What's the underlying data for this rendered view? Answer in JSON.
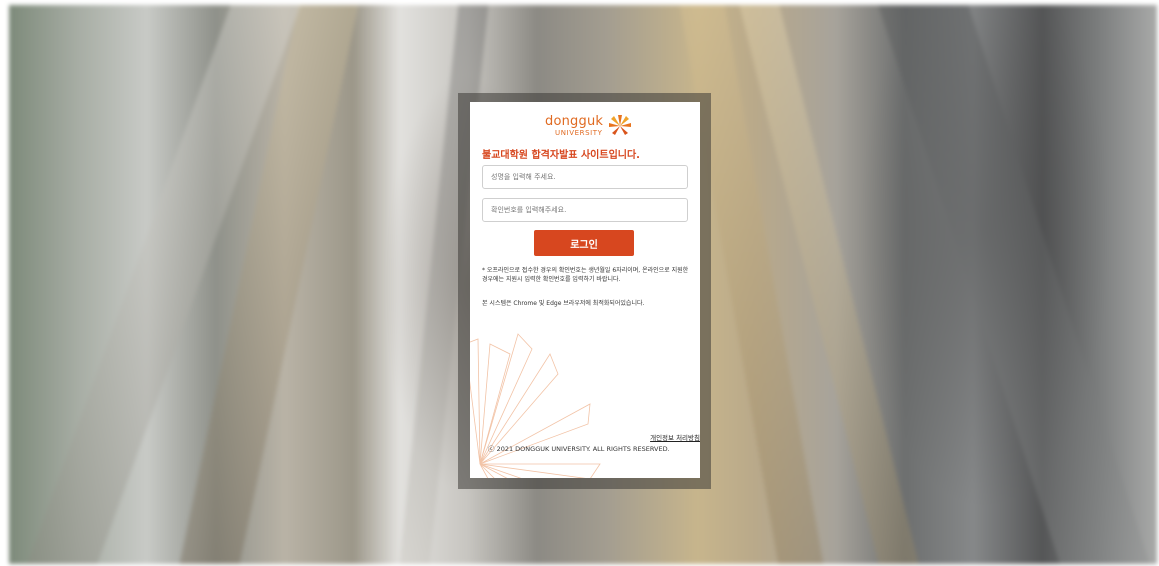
{
  "brand": {
    "logo_word": "dongguk",
    "logo_sub": "UNIVERSITY",
    "primary_color": "#d7471f",
    "logo_color": "#e06a21"
  },
  "headline": "불교대학원 합격자발표 사이트입니다.",
  "form": {
    "name_placeholder": "성명을 입력해 주세요.",
    "code_placeholder": "확인번호를 입력해주세요.",
    "login_label": "로그인"
  },
  "notice": "* 오프라인으로 접수한 경우의 확인번호는 생년월일 6자리이며, 온라인으로 지원한 경우에는 지원시 입력한 확인번호를 입력하기 바랍니다.",
  "browser_note": "본 시스템은 Chrome 및 Edge 브라우저에 최적화되어있습니다.",
  "footer": {
    "privacy_link": "개인정보 처리방침",
    "copyright": "ⓒ 2021 DONGGUK UNIVERSITY. ALL RIGHTS RESERVED."
  }
}
